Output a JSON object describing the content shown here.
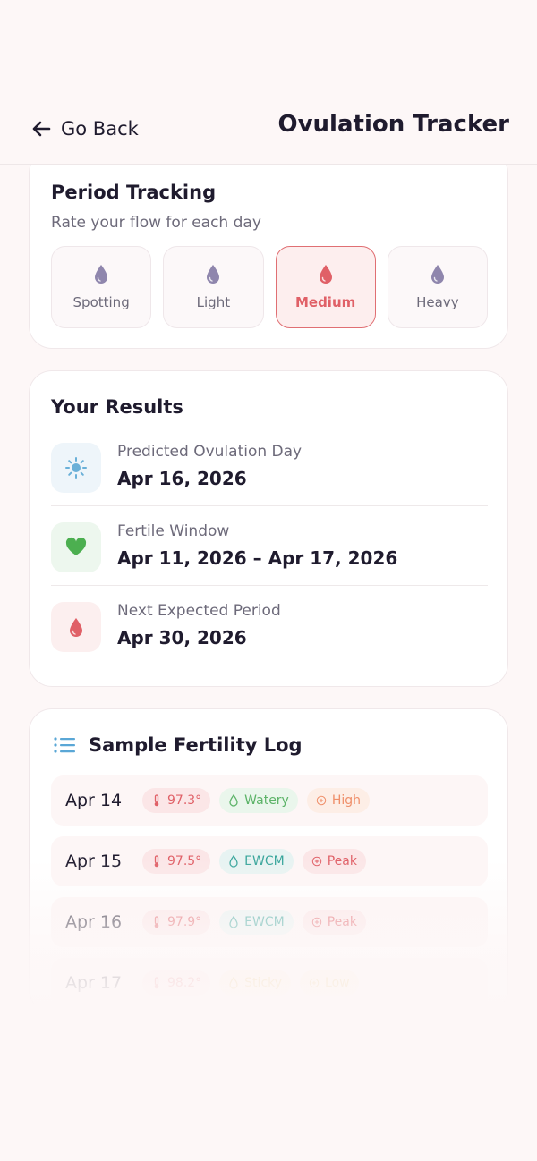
{
  "header": {
    "back_label": "Go Back",
    "title": "Ovulation Tracker"
  },
  "period": {
    "title": "Period Tracking",
    "subtitle": "Rate your flow for each day",
    "options": [
      {
        "label": "Spotting",
        "selected": false
      },
      {
        "label": "Light",
        "selected": false
      },
      {
        "label": "Medium",
        "selected": true
      },
      {
        "label": "Heavy",
        "selected": false
      }
    ]
  },
  "results": {
    "title": "Your Results",
    "items": [
      {
        "label": "Predicted Ovulation Day",
        "value": "Apr 16, 2026",
        "icon": "sun-icon"
      },
      {
        "label": "Fertile Window",
        "value": "Apr 11, 2026 – Apr 17, 2026",
        "icon": "heart-icon"
      },
      {
        "label": "Next Expected Period",
        "value": "Apr 30, 2026",
        "icon": "drop-icon"
      }
    ]
  },
  "log": {
    "title": "Sample Fertility Log",
    "rows": [
      {
        "date": "Apr 14",
        "temp": "97.3°",
        "mucus": "Watery",
        "fertility": "High"
      },
      {
        "date": "Apr 15",
        "temp": "97.5°",
        "mucus": "EWCM",
        "fertility": "Peak"
      },
      {
        "date": "Apr 16",
        "temp": "97.9°",
        "mucus": "EWCM",
        "fertility": "Peak"
      },
      {
        "date": "Apr 17",
        "temp": "98.2°",
        "mucus": "Sticky",
        "fertility": "Low"
      }
    ]
  },
  "colors": {
    "accent": "#e06067",
    "drop_neutral": "#8f86ad",
    "heart": "#4caf50",
    "sun": "#6ab0d8"
  }
}
